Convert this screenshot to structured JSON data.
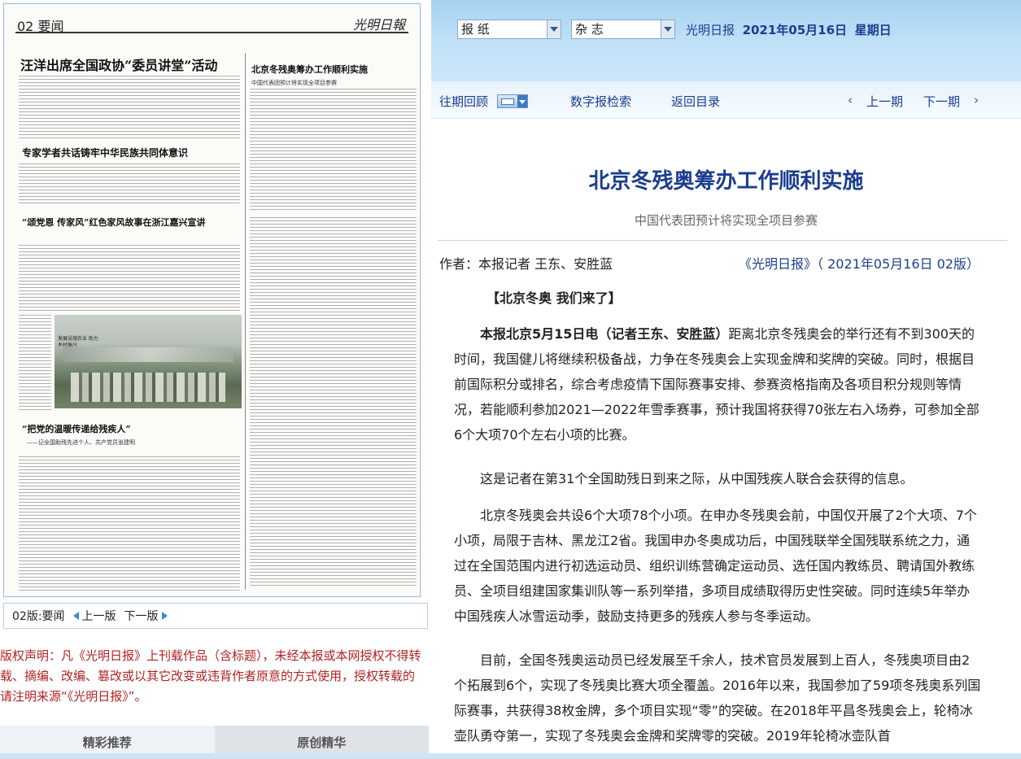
{
  "left": {
    "page_image": {
      "page_no": "02 要闻",
      "paper_logo": "光明日報",
      "headlines": [
        {
          "text": "汪洋出席全国政协“委员讲堂”活动"
        },
        {
          "text": "北京冬残奥筹办工作顺利实施"
        },
        {
          "text": "专家学者共话铸牢中华民族共同体意识"
        },
        {
          "text": "“颂党恩 传家风”红色家风故事在浙江嘉兴宣讲"
        },
        {
          "text": "“把党的温暖传递给残疾人”"
        }
      ],
      "subheads": [
        {
          "text": "中国代表团预计将实现全项目参赛"
        },
        {
          "text": "——记全国助残先进个人、共产党员张建明"
        }
      ],
      "photo_caption": "发展设施农业 助力乡村振兴"
    },
    "edition_bar": {
      "edition_label": "02版:要闻",
      "prev_label": "上一版",
      "next_label": "下一版"
    },
    "copyright": "版权声明：凡《光明日报》上刊载作品（含标题），未经本报或本网授权不得转载、摘编、改编、篡改或以其它改变或违背作者原意的方式使用，授权转载的请注明来源“《光明日报》”。",
    "tabs": [
      "精彩推荐",
      "原创精华"
    ]
  },
  "topbar": {
    "select1": "报  纸",
    "select2": "杂  志",
    "paper_name": "光明日报",
    "date": "2021年05月16日",
    "weekday": "星期日"
  },
  "navbar": {
    "archive": "往期回顾",
    "digital": "数字报检索",
    "back": "返回目录",
    "prev_issue": "上一期",
    "next_issue": "下一期"
  },
  "article": {
    "title": "北京冬残奥筹办工作顺利实施",
    "subtitle": "中国代表团预计将实现全项目参赛",
    "author": "作者：本报记者 王东、安胜蓝",
    "source": "《光明日报》（ 2021年05月16日   02版）",
    "section": "【北京冬奥   我们来了】",
    "p1_lead": "本报北京5月15日电（记者王东、安胜蓝）",
    "p1": "距离北京冬残奥会的举行还有不到300天的时间，我国健儿将继续积极备战，力争在冬残奥会上实现金牌和奖牌的突破。同时，根据目前国际积分或排名，综合考虑疫情下国际赛事安排、参赛资格指南及各项目积分规则等情况，若能顺利参加2021—2022年雪季赛事，预计我国将获得70张左右入场券，可参加全部6个大项70个左右小项的比赛。",
    "p2": "这是记者在第31个全国助残日到来之际，从中国残疾人联合会获得的信息。",
    "p3": "北京冬残奥会共设6个大项78个小项。在申办冬残奥会前，中国仅开展了2个大项、7个小项，局限于吉林、黑龙江2省。我国申办冬奥成功后，中国残联举全国残联系统之力，通过在全国范围内进行初选运动员、组织训练营确定运动员、选任国内教练员、聘请国外教练员、全项目组建国家集训队等一系列举措，多项目成绩取得历史性突破。同时连续5年举办中国残疾人冰雪运动季，鼓励支持更多的残疾人参与冬季运动。",
    "p4": "目前，全国冬残奥运动员已经发展至千余人，技术官员发展到上百人，冬残奥项目由2个拓展到6个，实现了冬残奥比赛大项全覆盖。2016年以来，我国参加了59项冬残奥系列国际赛事，共获得38枚金牌，多个项目实现“零”的突破。在2018年平昌冬残奥会上，轮椅冰壶队勇夺第一，实现了冬残奥会金牌和奖牌零的突破。2019年轮椅冰壶队首"
  }
}
